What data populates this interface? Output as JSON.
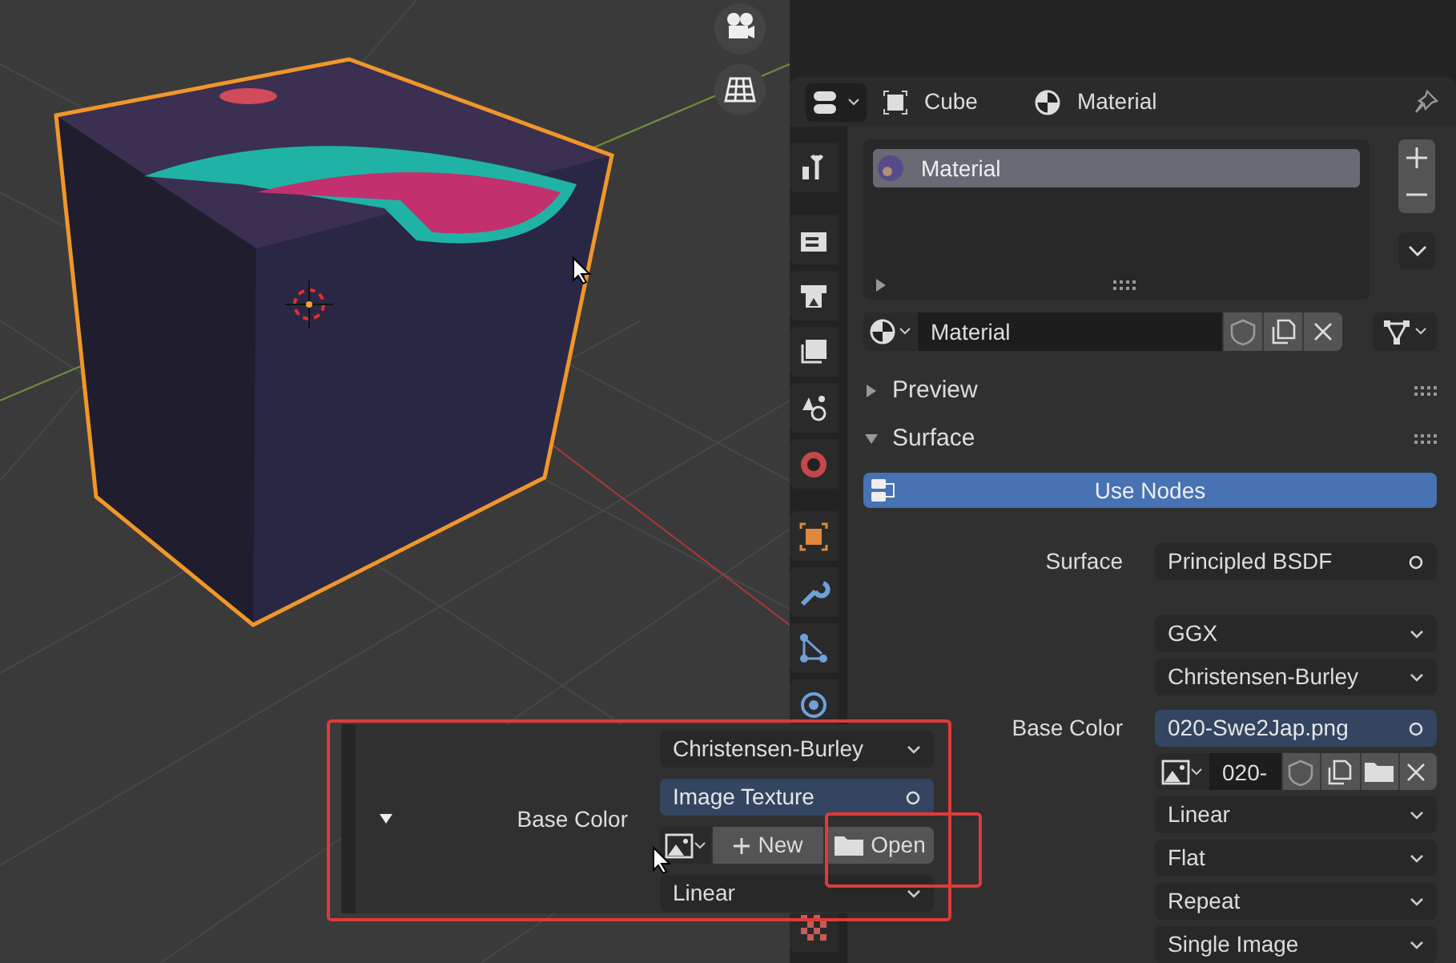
{
  "viewport": {
    "gizmos": [
      {
        "kind": "camera"
      },
      {
        "kind": "grid"
      }
    ]
  },
  "popup": {
    "expanded": true,
    "label": "Base Color",
    "dropdown": "Christensen-Burley",
    "link": "Image Texture",
    "buttons": [
      "New",
      "Open"
    ],
    "interpolation": "Linear"
  },
  "properties": {
    "breadcrumbs": [
      "Cube",
      "Material"
    ],
    "tabs": [
      {
        "kind": "tool"
      },
      {
        "kind": "render"
      },
      {
        "kind": "output"
      },
      {
        "kind": "view-layer"
      },
      {
        "kind": "scene"
      },
      {
        "kind": "world"
      },
      {
        "kind": "object"
      },
      {
        "kind": "modifier"
      },
      {
        "kind": "particles"
      },
      {
        "kind": "physics"
      },
      {
        "kind": "texture"
      }
    ],
    "material_slots": [
      {
        "name": "Material",
        "selected": true
      }
    ],
    "material_field": "Material",
    "panels": [
      {
        "title": "Preview",
        "expanded": false
      },
      {
        "title": "Surface",
        "expanded": true
      }
    ],
    "use_nodes": "Use Nodes",
    "rows": [
      {
        "kind": "link",
        "label": "Surface",
        "value": "Principled BSDF"
      },
      {
        "kind": "dropdown",
        "value": "GGX"
      },
      {
        "kind": "dropdown",
        "value": "Christensen-Burley"
      },
      {
        "kind": "link",
        "label": "Base Color",
        "value": "020-Swe2Jap.png"
      },
      {
        "kind": "image",
        "value": "020-"
      },
      {
        "kind": "dropdown",
        "value": "Linear"
      },
      {
        "kind": "dropdown",
        "value": "Flat"
      },
      {
        "kind": "dropdown",
        "value": "Repeat"
      },
      {
        "kind": "dropdown",
        "value": "Single Image"
      }
    ]
  }
}
